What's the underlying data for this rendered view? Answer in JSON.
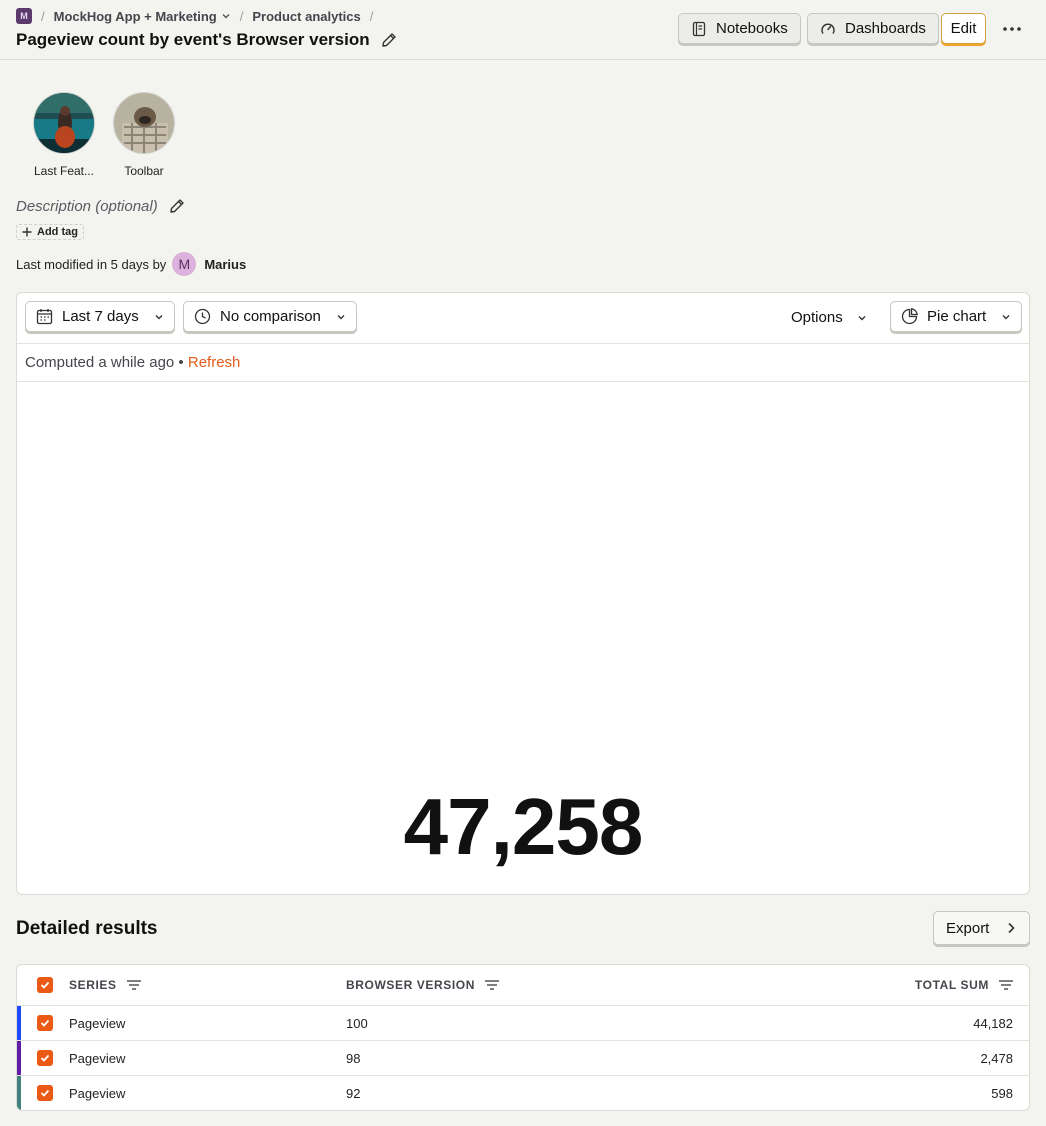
{
  "breadcrumbs": {
    "project_badge": "M",
    "project": "MockHog App + Marketing",
    "section": "Product analytics"
  },
  "title": "Pageview count by event's Browser version",
  "header_buttons": {
    "notebooks": "Notebooks",
    "dashboards": "Dashboards",
    "edit": "Edit"
  },
  "notebooks_list": [
    {
      "label": "Last Feat...",
      "icon": "avatar-photo-lake"
    },
    {
      "label": "Toolbar",
      "icon": "avatar-photo-pug"
    }
  ],
  "description_placeholder": "Description (optional)",
  "add_tag": "Add tag",
  "modified": {
    "text": "Last modified in 5 days by",
    "avatar_initial": "M",
    "user": "Marius"
  },
  "toolbar": {
    "date_range": "Last 7 days",
    "comparison": "No comparison",
    "options": "Options",
    "chart_type": "Pie chart"
  },
  "status": {
    "computed": "Computed a while ago •",
    "refresh": "Refresh"
  },
  "big_number": "47,258",
  "results": {
    "title": "Detailed results",
    "export": "Export",
    "headers": [
      "SERIES",
      "BROWSER VERSION",
      "TOTAL SUM"
    ],
    "rows": [
      {
        "series": "Pageview",
        "browser_version": "100",
        "total": "44,182",
        "color": "#1d4aff"
      },
      {
        "series": "Pageview",
        "browser_version": "98",
        "total": "2,478",
        "color": "#621da6"
      },
      {
        "series": "Pageview",
        "browser_version": "92",
        "total": "598",
        "color": "#42827e"
      }
    ]
  },
  "colors": {
    "accent_orange": "#eb5a14",
    "refresh_link": "#e35c1b",
    "edit_border": "#f0a52a"
  }
}
